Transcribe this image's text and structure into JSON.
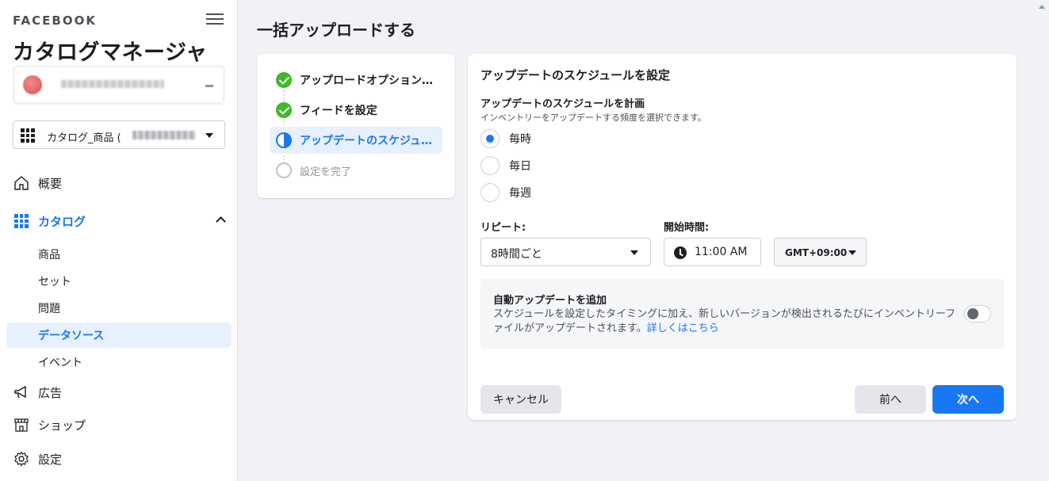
{
  "sidebar": {
    "brand": "FACEBOOK",
    "app_title": "カタログマネージャ",
    "catalog_select_label": "カタログ_商品 (",
    "nav": {
      "overview": "概要",
      "catalog": "カタログ",
      "catalog_sub": [
        "商品",
        "セット",
        "問題",
        "データソース",
        "イベント"
      ],
      "ads": "広告",
      "shop": "ショップ",
      "settings": "設定"
    }
  },
  "main": {
    "page_title": "一括アップロードする",
    "steps": [
      {
        "label": "アップロードオプション…",
        "state": "done"
      },
      {
        "label": "フィードを設定",
        "state": "done"
      },
      {
        "label": "アップデートのスケジュ…",
        "state": "current"
      },
      {
        "label": "設定を完了",
        "state": "pending"
      }
    ],
    "schedule": {
      "card_title": "アップデートのスケジュールを設定",
      "plan_title": "アップデートのスケジュールを計画",
      "plan_desc": "インベントリーをアップデートする頻度を選択できます。",
      "options": [
        "毎時",
        "毎日",
        "毎週"
      ],
      "selected": "毎時",
      "repeat_label": "リピート:",
      "repeat_value": "8時間ごと",
      "start_label": "開始時間:",
      "start_value": "11:00 AM",
      "timezone": "GMT+09:00"
    },
    "auto_update": {
      "title": "自動アップデートを追加",
      "text": "スケジュールを設定したタイミングに加え、新しいバージョンが検出されるたびにインベントリーファイルがアップデートされます。",
      "link": "詳しくはこちら",
      "enabled": false
    },
    "buttons": {
      "cancel": "キャンセル",
      "back": "前へ",
      "next": "次へ"
    }
  },
  "colors": {
    "accent": "#1877f2",
    "success": "#42b72a",
    "background": "#f0f2f5"
  }
}
